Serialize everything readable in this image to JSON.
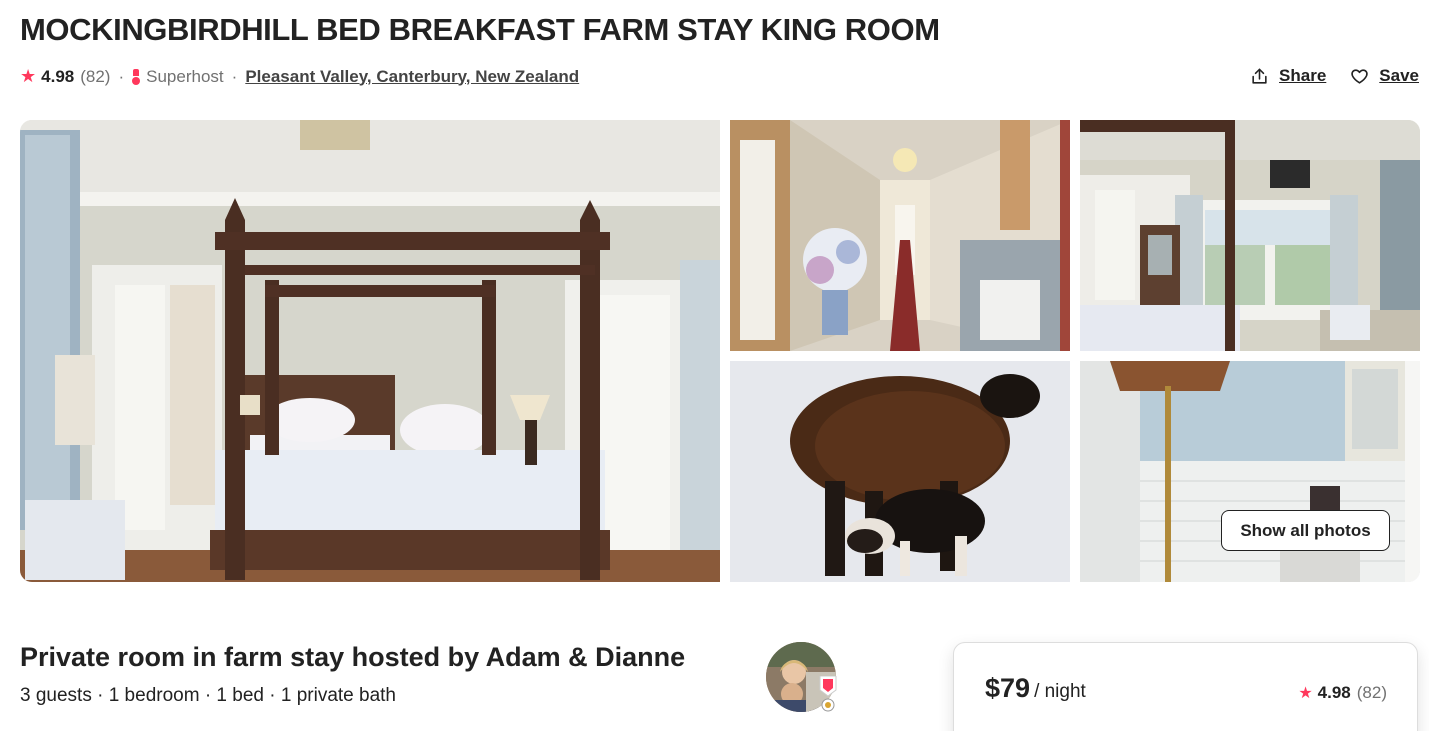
{
  "listing": {
    "title": "MOCKINGBIRDHILL BED BREAKFAST FARM STAY KING ROOM",
    "rating": "4.98",
    "reviews": "(82)",
    "superhost_label": "Superhost",
    "location": "Pleasant Valley, Canterbury, New Zealand",
    "separator": "·"
  },
  "actions": {
    "share_label": "Share",
    "save_label": "Save"
  },
  "gallery": {
    "show_all_label": "Show all photos",
    "photos": [
      "four-poster-bedroom",
      "hallway",
      "bedroom-french-doors",
      "sheep-in-snow",
      "bathroom"
    ]
  },
  "host": {
    "heading": "Private room in farm stay hosted by Adam & Dianne",
    "details": "3 guests · 1 bedroom · 1 bed · 1 private bath"
  },
  "booking": {
    "price": "$79",
    "per_night": "/ night",
    "rating": "4.98",
    "reviews": "(82)"
  },
  "colors": {
    "accent": "#FF385C",
    "text": "#222222",
    "muted": "#717171",
    "border": "#DDDDDD"
  },
  "icons": [
    "star-icon",
    "superhost-medal-icon",
    "share-icon",
    "heart-icon"
  ]
}
